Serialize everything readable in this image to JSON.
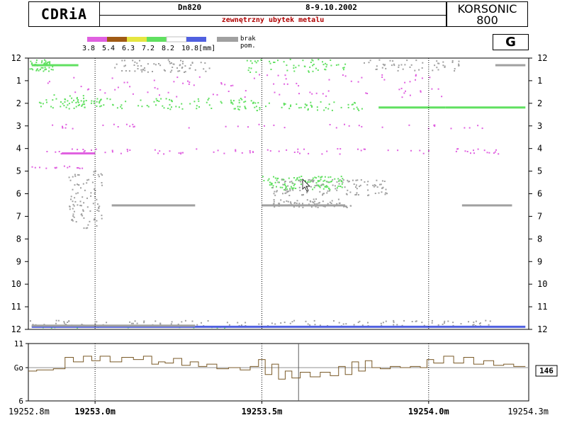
{
  "header": {
    "logo": "CDRiA",
    "pipe": "Dn820",
    "date": "8-9.10.2002",
    "subtitle": "zewnętrzny ubytek metalu",
    "device_line1": "KORSONIC",
    "device_line2": "800",
    "grade": "G"
  },
  "legend": {
    "items": [
      {
        "label": "3.8",
        "color": "#e060e0"
      },
      {
        "label": "5.4",
        "color": "#a05a14"
      },
      {
        "label": "6.3",
        "color": "#e6e640"
      },
      {
        "label": "7.2",
        "color": "#60e060"
      },
      {
        "label": "8.2",
        "color": "#ffffff"
      },
      {
        "label": "10.8[mm]",
        "color": "#5060e0"
      }
    ],
    "missing_color": "#a0a0a0",
    "missing_label1": "brak",
    "missing_label2": "pom."
  },
  "colors": {
    "magenta": "#e060e0",
    "green": "#60e060",
    "gray": "#a0a0a0",
    "blue": "#5060e0",
    "brown": "#a05a14",
    "profile": "#7a5a28",
    "grid": "#404040"
  },
  "chart_data": [
    {
      "type": "heatmap",
      "x_range": [
        19252.8,
        19254.3
      ],
      "y_ticks": [
        "12",
        "1",
        "2",
        "3",
        "4",
        "5",
        "6",
        "7",
        "8",
        "9",
        "10",
        "11",
        "12"
      ],
      "vertical_markers": [
        19253.0,
        19253.5,
        19254.0
      ],
      "streaks": [
        {
          "y": 4.2,
          "x0": 19252.9,
          "x1": 19253.0,
          "color": "magenta"
        },
        {
          "y": 2.17,
          "x0": 19253.85,
          "x1": 19254.05,
          "color": "green"
        },
        {
          "y": 2.17,
          "x0": 19254.05,
          "x1": 19254.29,
          "color": "green"
        },
        {
          "y": 11.87,
          "x0": 19252.81,
          "x1": 19254.29,
          "color": "blue"
        },
        {
          "y": 11.82,
          "x0": 19252.81,
          "x1": 19253.3,
          "color": "gray"
        },
        {
          "y": 6.5,
          "x0": 19253.05,
          "x1": 19253.3,
          "color": "gray"
        },
        {
          "y": 6.5,
          "x0": 19253.5,
          "x1": 19253.75,
          "color": "gray"
        },
        {
          "y": 6.5,
          "x0": 19254.1,
          "x1": 19254.25,
          "color": "gray"
        },
        {
          "y": 0.3,
          "x0": 19252.81,
          "x1": 19252.95,
          "color": "green"
        },
        {
          "y": 0.3,
          "x0": 19254.2,
          "x1": 19254.29,
          "color": "gray"
        }
      ],
      "clusters": [
        {
          "x": 19252.83,
          "y": 0.3,
          "rx": 0.05,
          "ry": 0.25,
          "n": 60,
          "color": "green"
        },
        {
          "x": 19253.2,
          "y": 0.3,
          "rx": 0.15,
          "ry": 0.3,
          "n": 70,
          "color": "gray"
        },
        {
          "x": 19253.6,
          "y": 0.3,
          "rx": 0.15,
          "ry": 0.3,
          "n": 60,
          "color": "green"
        },
        {
          "x": 19253.95,
          "y": 0.3,
          "rx": 0.15,
          "ry": 0.25,
          "n": 50,
          "color": "gray"
        },
        {
          "x": 19253.45,
          "y": 1.2,
          "rx": 0.6,
          "ry": 0.5,
          "n": 90,
          "color": "magenta"
        },
        {
          "x": 19253.2,
          "y": 2.0,
          "rx": 0.3,
          "ry": 0.25,
          "n": 90,
          "color": "green"
        },
        {
          "x": 19253.6,
          "y": 2.1,
          "rx": 0.2,
          "ry": 0.2,
          "n": 60,
          "color": "green"
        },
        {
          "x": 19252.93,
          "y": 1.9,
          "rx": 0.1,
          "ry": 0.3,
          "n": 40,
          "color": "green"
        },
        {
          "x": 19253.55,
          "y": 4.1,
          "rx": 0.7,
          "ry": 0.12,
          "n": 80,
          "color": "magenta"
        },
        {
          "x": 19253.55,
          "y": 3.0,
          "rx": 0.7,
          "ry": 0.1,
          "n": 40,
          "color": "magenta"
        },
        {
          "x": 19253.62,
          "y": 5.5,
          "rx": 0.12,
          "ry": 0.3,
          "n": 120,
          "color": "green"
        },
        {
          "x": 19253.7,
          "y": 5.7,
          "rx": 0.18,
          "ry": 0.35,
          "n": 120,
          "color": "gray"
        },
        {
          "x": 19253.65,
          "y": 6.4,
          "rx": 0.12,
          "ry": 0.2,
          "n": 70,
          "color": "gray"
        },
        {
          "x": 19252.97,
          "y": 6.2,
          "rx": 0.05,
          "ry": 1.3,
          "n": 90,
          "color": "gray"
        },
        {
          "x": 19252.9,
          "y": 4.8,
          "rx": 0.1,
          "ry": 0.05,
          "n": 15,
          "color": "magenta"
        },
        {
          "x": 19253.5,
          "y": 11.7,
          "rx": 0.7,
          "ry": 0.12,
          "n": 120,
          "color": "gray"
        },
        {
          "x": 19253.1,
          "y": 11.9,
          "rx": 0.3,
          "ry": 0.06,
          "n": 40,
          "color": "green"
        }
      ]
    },
    {
      "type": "line",
      "x_range": [
        19252.8,
        19254.3
      ],
      "ylim": [
        6,
        11
      ],
      "y_ticks": [
        "11",
        "Go",
        "6"
      ],
      "reference_y": 8.9,
      "cursor_x": 19253.61,
      "x_ticks": [
        {
          "x": 19252.8,
          "label": "19252.8m"
        },
        {
          "x": 19253.0,
          "label": "19253.0m"
        },
        {
          "x": 19253.5,
          "label": "19253.5m"
        },
        {
          "x": 19254.0,
          "label": "19254.0m"
        },
        {
          "x": 19254.3,
          "label": "19254.3m"
        }
      ],
      "value_box": "146",
      "profile": [
        [
          19252.8,
          8.6
        ],
        [
          19252.85,
          8.7
        ],
        [
          19252.9,
          8.8
        ],
        [
          19252.92,
          9.8
        ],
        [
          19252.95,
          9.4
        ],
        [
          19252.98,
          9.9
        ],
        [
          19253.0,
          9.5
        ],
        [
          19253.03,
          9.9
        ],
        [
          19253.06,
          9.4
        ],
        [
          19253.1,
          9.8
        ],
        [
          19253.13,
          9.6
        ],
        [
          19253.16,
          9.9
        ],
        [
          19253.18,
          9.2
        ],
        [
          19253.2,
          9.4
        ],
        [
          19253.22,
          9.3
        ],
        [
          19253.25,
          9.7
        ],
        [
          19253.27,
          9.1
        ],
        [
          19253.3,
          9.4
        ],
        [
          19253.32,
          9.0
        ],
        [
          19253.35,
          9.2
        ],
        [
          19253.38,
          8.8
        ],
        [
          19253.42,
          8.9
        ],
        [
          19253.45,
          8.7
        ],
        [
          19253.48,
          9.0
        ],
        [
          19253.5,
          9.6
        ],
        [
          19253.52,
          8.3
        ],
        [
          19253.54,
          9.2
        ],
        [
          19253.56,
          7.9
        ],
        [
          19253.58,
          8.6
        ],
        [
          19253.6,
          8.0
        ],
        [
          19253.63,
          8.5
        ],
        [
          19253.66,
          8.1
        ],
        [
          19253.69,
          8.5
        ],
        [
          19253.72,
          8.2
        ],
        [
          19253.74,
          9.0
        ],
        [
          19253.76,
          8.3
        ],
        [
          19253.78,
          9.4
        ],
        [
          19253.8,
          8.6
        ],
        [
          19253.82,
          9.5
        ],
        [
          19253.84,
          8.9
        ],
        [
          19253.87,
          8.8
        ],
        [
          19253.9,
          9.0
        ],
        [
          19253.93,
          8.9
        ],
        [
          19253.96,
          9.0
        ],
        [
          19253.99,
          8.9
        ],
        [
          19254.0,
          9.6
        ],
        [
          19254.03,
          9.3
        ],
        [
          19254.06,
          9.9
        ],
        [
          19254.09,
          9.3
        ],
        [
          19254.12,
          9.8
        ],
        [
          19254.15,
          9.2
        ],
        [
          19254.18,
          9.5
        ],
        [
          19254.21,
          9.1
        ],
        [
          19254.24,
          9.2
        ],
        [
          19254.27,
          9.0
        ],
        [
          19254.29,
          9.0
        ]
      ]
    }
  ]
}
